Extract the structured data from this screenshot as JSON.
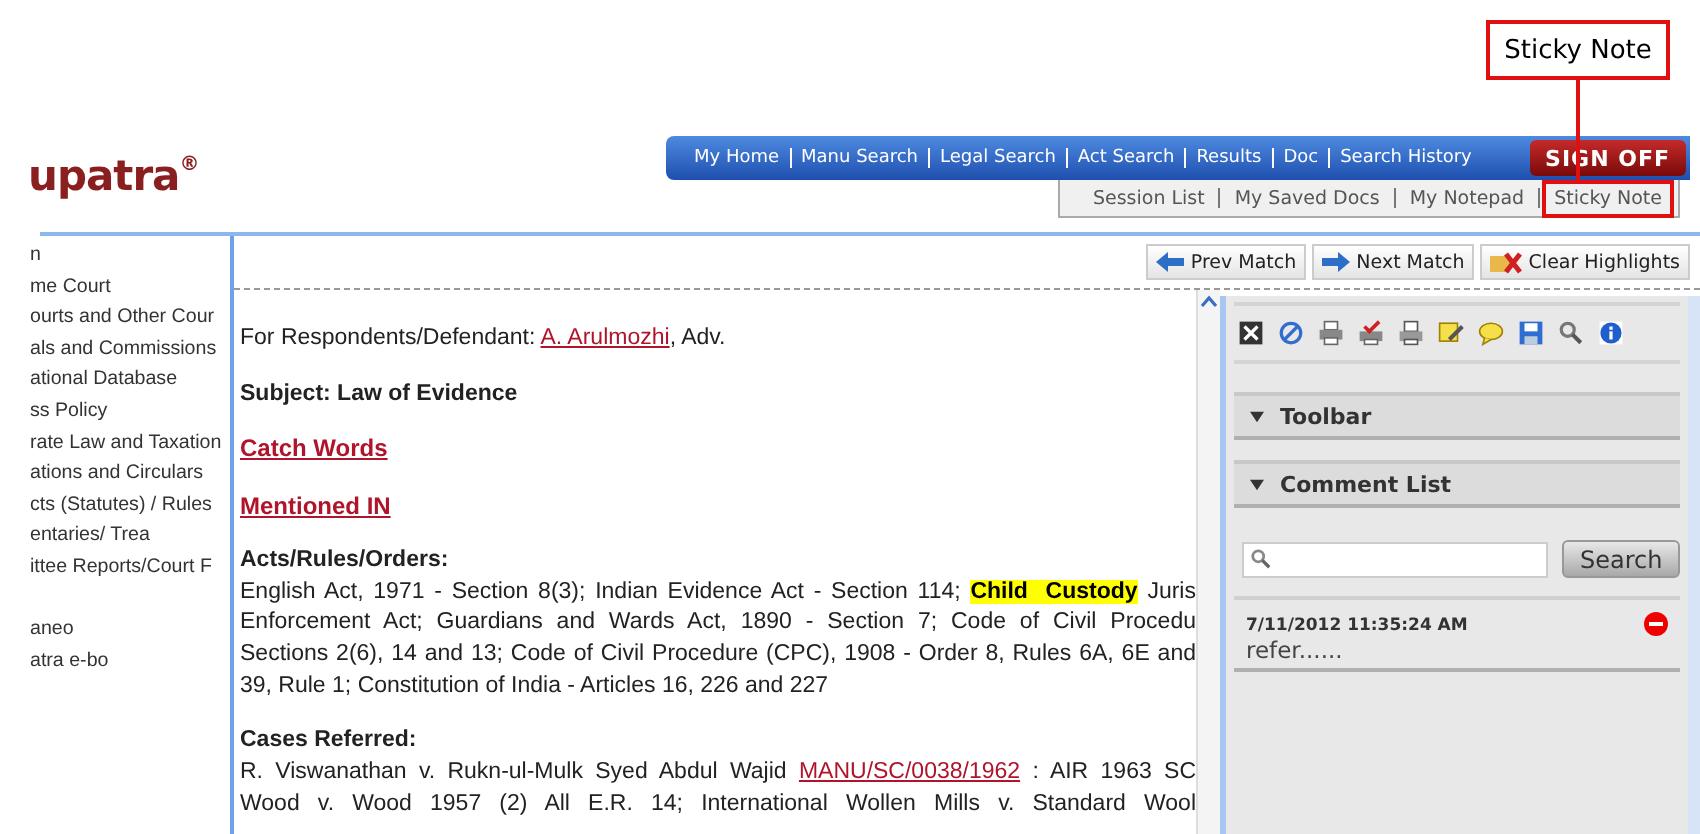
{
  "callout": {
    "label": "Sticky Note"
  },
  "logo": {
    "text": "upatra",
    "mark": "®"
  },
  "nav": {
    "items": [
      "My Home",
      "Manu Search",
      "Legal Search",
      "Act Search",
      "Results",
      "Doc",
      "Search History"
    ],
    "sign_off": "SIGN OFF"
  },
  "subnav": {
    "items": [
      {
        "label": "Session List",
        "annotated": false
      },
      {
        "label": "My Saved Docs",
        "annotated": false
      },
      {
        "label": "My Notepad",
        "annotated": false
      },
      {
        "label": "Sticky Note",
        "annotated": true
      }
    ]
  },
  "sidebar": {
    "groups": [
      [
        "n",
        "me Court",
        "ourts and Other Cour",
        "als and Commissions",
        "ational Database",
        "ss Policy",
        "rate Law and Taxation",
        "ations and Circulars",
        "cts (Statutes) / Rules",
        "entaries/ Trea",
        "ittee Reports/Court F"
      ],
      [
        "aneo",
        "atra e-bo"
      ]
    ]
  },
  "match_buttons": [
    {
      "kind": "prev",
      "label": "Prev Match"
    },
    {
      "kind": "next",
      "label": "Next Match"
    },
    {
      "kind": "clear",
      "label": "Clear Highlights"
    }
  ],
  "document": {
    "respondents": {
      "prefix": "For Respondents/Defendant: ",
      "link": "A. Arulmozhi",
      "suffix": ", Adv."
    },
    "subject": "Subject: Law of Evidence",
    "links": [
      "Catch Words",
      "Mentioned IN"
    ],
    "acts": {
      "heading": "Acts/Rules/Orders:",
      "lines": [
        [
          {
            "text": "English Act, 1971 - Section 8(3); Indian Evidence Act - Section 114; ",
            "highlight": false
          },
          {
            "text": "Child Custody",
            "highlight": true
          },
          {
            "text": " Juris",
            "highlight": false
          }
        ],
        [
          {
            "text": "Enforcement Act; Guardians and Wards Act, 1890 - Section 7; Code of Civil Procedu",
            "highlight": false
          }
        ],
        [
          {
            "text": "Sections 2(6), 14 and 13; Code of Civil Procedure (CPC), 1908 - Order 8, Rules 6A, 6E and",
            "highlight": false
          }
        ],
        [
          {
            "text": "39, Rule 1; Constitution of India - Articles 16, 226 and 227",
            "highlight": false
          }
        ]
      ]
    },
    "cases": {
      "heading": "Cases Referred:",
      "lines": [
        {
          "prefix": "R. Viswanathan v. Rukn-ul-Mulk Syed Abdul Wajid ",
          "link": "MANU/SC/0038/1962",
          "suffix": " : AIR 1963 SC"
        },
        {
          "prefix": "Wood v. Wood 1957 (2) All E.R. 14; International Wollen Mills v. Standard Wool"
        }
      ]
    }
  },
  "panel": {
    "sections": [
      {
        "title": "Toolbar",
        "expanded": true
      },
      {
        "title": "Comment List",
        "expanded": true
      }
    ],
    "search": {
      "button": "Search"
    },
    "comments": [
      {
        "time": "7/11/2012 11:35:24 AM",
        "text": "refer......"
      }
    ]
  }
}
